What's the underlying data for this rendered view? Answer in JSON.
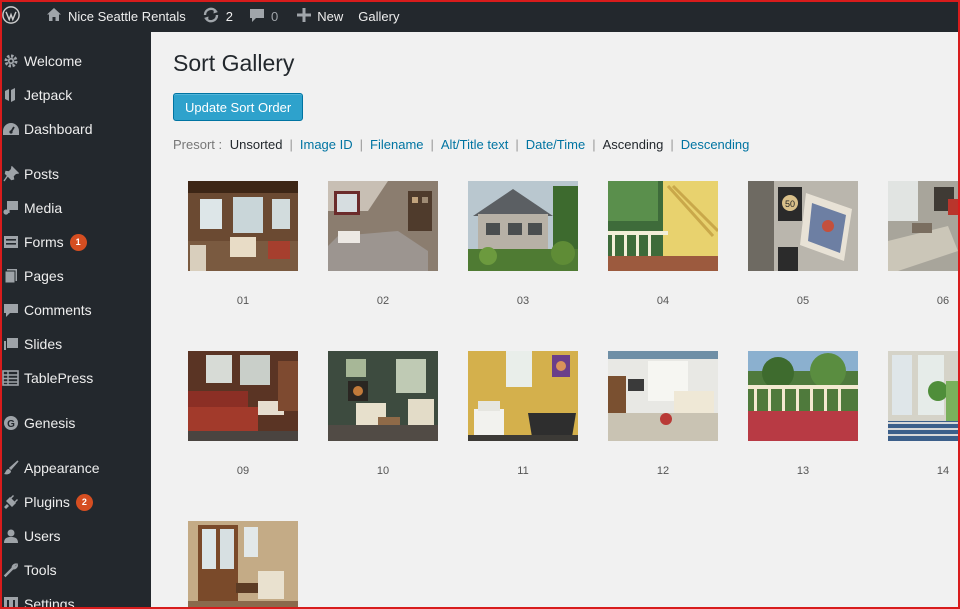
{
  "adminbar": {
    "site_name": "Nice Seattle Rentals",
    "updates_count": "2",
    "comments_count": "0",
    "new_label": "New",
    "gallery_label": "Gallery"
  },
  "sidebar": {
    "items": [
      {
        "label": "Welcome",
        "icon": "gear-icon"
      },
      {
        "label": "Jetpack",
        "icon": "jetpack-icon"
      },
      {
        "label": "Dashboard",
        "icon": "dashboard-icon"
      },
      {
        "label": "Posts",
        "icon": "pin-icon"
      },
      {
        "label": "Media",
        "icon": "media-icon"
      },
      {
        "label": "Forms",
        "icon": "forms-icon",
        "badge": "1"
      },
      {
        "label": "Pages",
        "icon": "pages-icon"
      },
      {
        "label": "Comments",
        "icon": "comment-icon"
      },
      {
        "label": "Slides",
        "icon": "slides-icon"
      },
      {
        "label": "TablePress",
        "icon": "table-icon"
      },
      {
        "label": "Genesis",
        "icon": "genesis-icon"
      },
      {
        "label": "Appearance",
        "icon": "brush-icon"
      },
      {
        "label": "Plugins",
        "icon": "plugin-icon",
        "badge": "2"
      },
      {
        "label": "Users",
        "icon": "users-icon"
      },
      {
        "label": "Tools",
        "icon": "wrench-icon"
      },
      {
        "label": "Settings",
        "icon": "settings-icon"
      }
    ]
  },
  "main": {
    "title": "Sort Gallery",
    "update_button": "Update Sort Order",
    "presort": {
      "label": "Presort :",
      "options": [
        "Unsorted",
        "Image ID",
        "Filename",
        "Alt/Title text",
        "Date/Time",
        "Ascending",
        "Descending"
      ]
    },
    "gallery": [
      {
        "caption": "01"
      },
      {
        "caption": "02"
      },
      {
        "caption": "03"
      },
      {
        "caption": "04"
      },
      {
        "caption": "05"
      },
      {
        "caption": "06"
      },
      {
        "caption": "09"
      },
      {
        "caption": "10"
      },
      {
        "caption": "11"
      },
      {
        "caption": "12"
      },
      {
        "caption": "13"
      },
      {
        "caption": "14"
      },
      {
        "caption": ""
      }
    ]
  },
  "colors": {
    "adminbar": "#23282d",
    "sidebar": "#23282d",
    "accent": "#2ea2cc",
    "link": "#0074a2",
    "badge": "#d54e21",
    "frame": "#d81c1c"
  }
}
